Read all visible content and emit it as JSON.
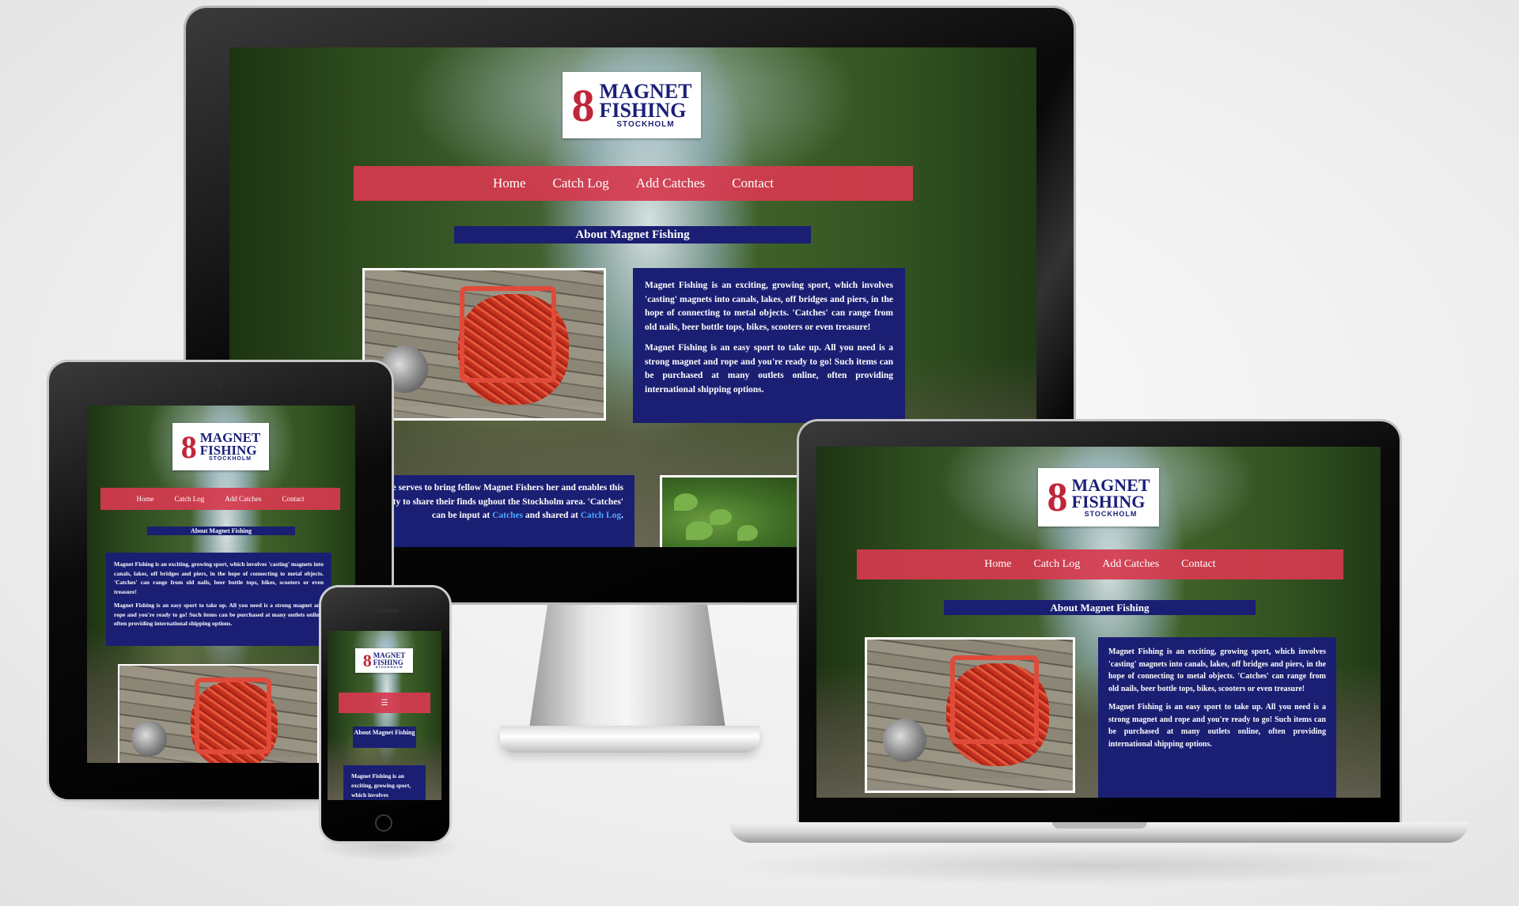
{
  "site": {
    "logo": {
      "line1": "MAGNET",
      "line2": "FISHING",
      "line3": "STOCKHOLM"
    },
    "nav": [
      {
        "label": "Home"
      },
      {
        "label": "Catch Log"
      },
      {
        "label": "Add Catches"
      },
      {
        "label": "Contact"
      }
    ],
    "about_heading": "About Magnet Fishing",
    "paragraph1": "Magnet Fishing is an exciting, growing sport, which involves 'casting' magnets into canals, lakes, off bridges and piers, in the hope of connecting to metal objects. 'Catches' can range from old nails, beer bottle tops, bikes, scooters or even treasure!",
    "paragraph2": "Magnet Fishing is an easy sport to take up. All you need is a strong magnet and rope and you're ready to go! Such items can be purchased at many outlets online, often providing international shipping options.",
    "paragraph3_lead": "Website serves to bring fellow Magnet Fishers",
    "paragraph3_rest": "her and enables this community to share their finds ughout the Stockholm area. 'Catches' can be input at",
    "paragraph3_link1": "Catches",
    "paragraph3_mid": " and shared at ",
    "paragraph3_link2": "Catch Log",
    "paragraph3_end": ".",
    "phone_paragraph": "Magnet Fishing is an exciting, growing sport, which involves"
  },
  "devices": [
    "desktop-monitor",
    "tablet",
    "laptop",
    "phone"
  ],
  "colors": {
    "nav": "#d63a4e",
    "card": "#1a1f73",
    "link": "#4aa6ff"
  }
}
